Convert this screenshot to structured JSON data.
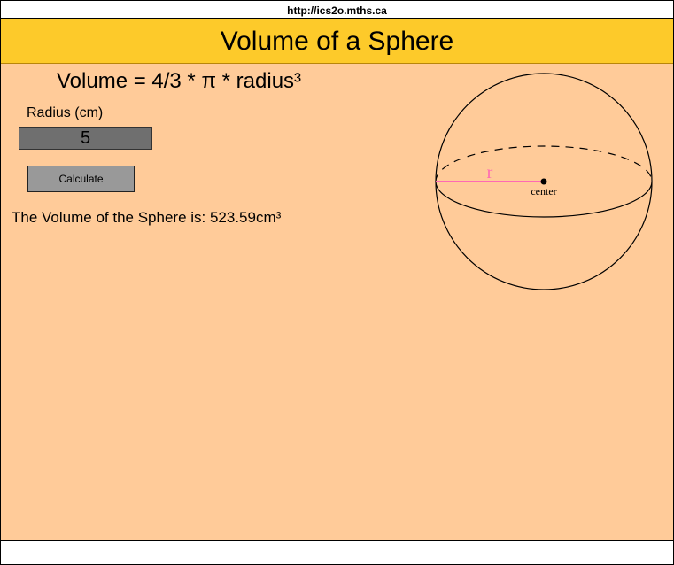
{
  "browser": {
    "url": "http://ics2o.mths.ca"
  },
  "header": {
    "title": "Volume of a Sphere"
  },
  "main": {
    "formula": "Volume = 4/3 * π * radius³",
    "radius_label": "Radius (cm)",
    "radius_value": "5",
    "calculate_label": "Calculate",
    "result_text": "The Volume of the Sphere is: 523.59cm³"
  },
  "diagram": {
    "radius_symbol": "r",
    "center_label": "center",
    "radius_color": "#ff69b4"
  },
  "colors": {
    "header_bg": "#fdca2a",
    "main_bg": "#ffcb99",
    "input_bg": "#6f6f6f",
    "button_bg": "#999999"
  }
}
